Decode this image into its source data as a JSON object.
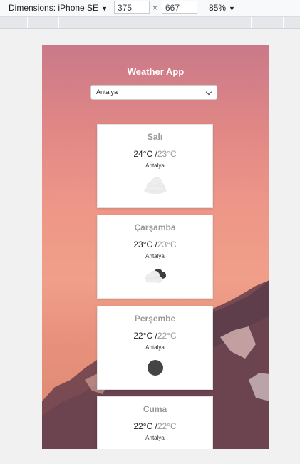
{
  "toolbar": {
    "device_label": "Dimensions: iPhone SE",
    "width": "375",
    "times": "×",
    "height": "667",
    "zoom": "85%"
  },
  "app": {
    "title": "Weather App",
    "selected_city": "Antalya"
  },
  "forecast": [
    {
      "day": "Salı",
      "max": "24°C /",
      "min": "23°C",
      "city": "Antalya",
      "icon": "cloud-icon"
    },
    {
      "day": "Çarşamba",
      "max": "23°C /",
      "min": "23°C",
      "city": "Antalya",
      "icon": "broken-clouds-icon"
    },
    {
      "day": "Perşembe",
      "max": "22°C /",
      "min": "22°C",
      "city": "Antalya",
      "icon": "dark-dot-icon"
    },
    {
      "day": "Cuma",
      "max": "22°C /",
      "min": "22°C",
      "city": "Antalya",
      "icon": "cloud-icon"
    }
  ]
}
